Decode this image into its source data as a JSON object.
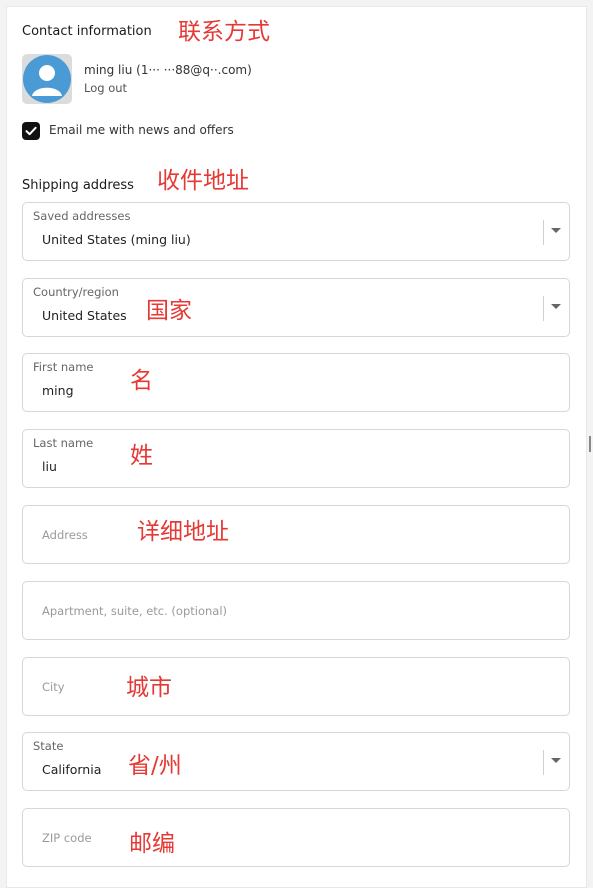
{
  "contact": {
    "heading": "Contact information",
    "annotation": "联系方式",
    "user": "ming liu (1···  ···88@q··.com)",
    "logout": "Log out",
    "newsletter_label": "Email me with news and offers",
    "newsletter_checked": true
  },
  "shipping": {
    "heading": "Shipping address",
    "annotation": "收件地址",
    "saved": {
      "label": "Saved addresses",
      "value": "United States (ming liu)"
    },
    "country": {
      "label": "Country/region",
      "value": "United States",
      "annotation": "国家"
    },
    "first_name": {
      "label": "First name",
      "value": "ming",
      "annotation": "名"
    },
    "last_name": {
      "label": "Last name",
      "value": "liu",
      "annotation": "姓"
    },
    "address": {
      "placeholder": "Address",
      "annotation": "详细地址"
    },
    "apartment": {
      "placeholder": "Apartment, suite, etc. (optional)"
    },
    "city": {
      "placeholder": "City",
      "annotation": "城市"
    },
    "state": {
      "label": "State",
      "value": "California",
      "annotation": "省/州"
    },
    "zip": {
      "placeholder": "ZIP code",
      "annotation": "邮编"
    }
  },
  "colors": {
    "annotation": "#e53935",
    "checkbox": "#111111"
  },
  "icons": {
    "avatar": "avatar-icon",
    "check": "check-icon",
    "select": "chevron-down-icon"
  }
}
